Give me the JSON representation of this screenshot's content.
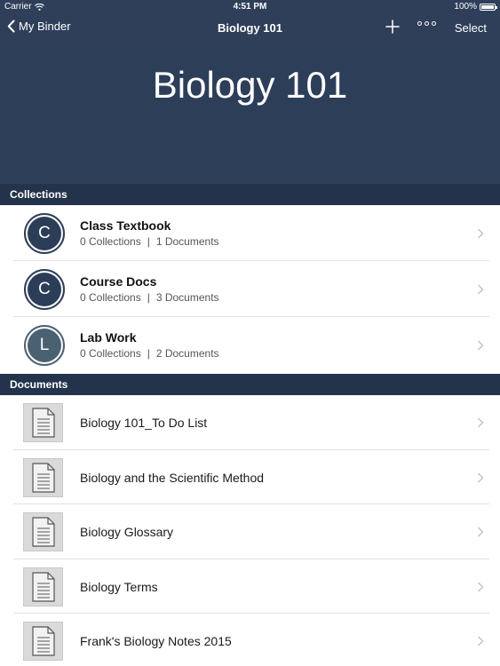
{
  "status": {
    "carrier": "Carrier",
    "time": "4:51 PM",
    "battery": "100%"
  },
  "nav": {
    "back_label": "My Binder",
    "title": "Biology 101",
    "select_label": "Select",
    "icons": [
      "chevron-left-icon",
      "plus-icon",
      "more-icon"
    ]
  },
  "hero": {
    "title": "Biology 101"
  },
  "collections": {
    "header": "Collections",
    "items": [
      {
        "initial": "C",
        "title": "Class Textbook",
        "collections": "0 Collections",
        "documents": "1 Documents",
        "color": "#2c3d58"
      },
      {
        "initial": "C",
        "title": "Course Docs",
        "collections": "0 Collections",
        "documents": "3 Documents",
        "color": "#2c3d58"
      },
      {
        "initial": "L",
        "title": "Lab Work",
        "collections": "0 Collections",
        "documents": "2 Documents",
        "color": "#4a6171"
      }
    ]
  },
  "documents": {
    "header": "Documents",
    "items": [
      {
        "name": "Biology 101_To Do List"
      },
      {
        "name": "Biology and the Scientific Method"
      },
      {
        "name": "Biology Glossary"
      },
      {
        "name": "Biology Terms"
      },
      {
        "name": "Frank's Biology Notes 2015"
      }
    ]
  },
  "colors": {
    "nav_bg": "#2f3f5a",
    "hero_bg": "#2d3e59",
    "section_header_bg": "#24334c"
  }
}
